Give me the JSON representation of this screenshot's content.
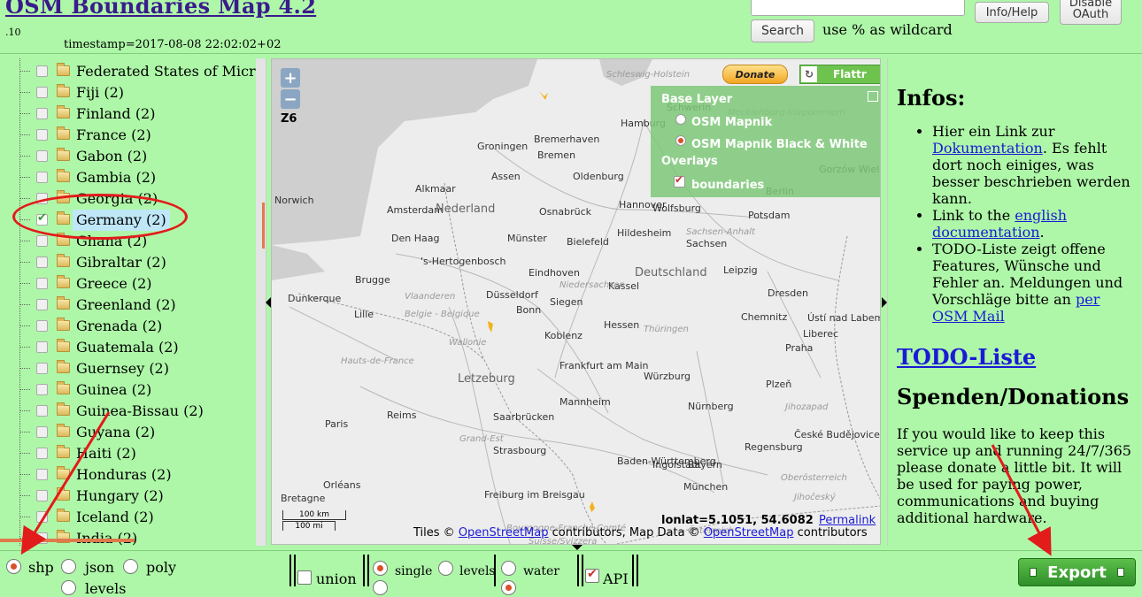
{
  "header": {
    "title": "OSM Boundaries Map 4.2",
    "version_suffix": ".10",
    "timestamp": "timestamp=2017-08-08 22:02:02+02",
    "search_value": "",
    "search_button": "Search",
    "wildcard_hint": "use % as wildcard",
    "info_button": "Info/Help",
    "oauth_button_line1": "Disable",
    "oauth_button_line2": "OAuth"
  },
  "tree": {
    "items": [
      {
        "label": "Federated States of Micronesia",
        "checked": false
      },
      {
        "label": "Fiji (2)",
        "checked": false
      },
      {
        "label": "Finland (2)",
        "checked": false
      },
      {
        "label": "France (2)",
        "checked": false
      },
      {
        "label": "Gabon (2)",
        "checked": false
      },
      {
        "label": "Gambia (2)",
        "checked": false
      },
      {
        "label": "Georgia (2)",
        "checked": false
      },
      {
        "label": "Germany (2)",
        "checked": true
      },
      {
        "label": "Ghana (2)",
        "checked": false
      },
      {
        "label": "Gibraltar (2)",
        "checked": false
      },
      {
        "label": "Greece (2)",
        "checked": false
      },
      {
        "label": "Greenland (2)",
        "checked": false
      },
      {
        "label": "Grenada (2)",
        "checked": false
      },
      {
        "label": "Guatemala (2)",
        "checked": false
      },
      {
        "label": "Guernsey (2)",
        "checked": false
      },
      {
        "label": "Guinea (2)",
        "checked": false
      },
      {
        "label": "Guinea-Bissau (2)",
        "checked": false
      },
      {
        "label": "Guyana (2)",
        "checked": false
      },
      {
        "label": "Haiti (2)",
        "checked": false
      },
      {
        "label": "Honduras (2)",
        "checked": false
      },
      {
        "label": "Hungary (2)",
        "checked": false
      },
      {
        "label": "Iceland (2)",
        "checked": false
      },
      {
        "label": "India (2)",
        "checked": false
      }
    ]
  },
  "map": {
    "zoom_in": "+",
    "zoom_out": "−",
    "zoom_level": "Z6",
    "donate": "Donate",
    "flattr": "Flattr",
    "layer_switcher": {
      "base_layer_title": "Base Layer",
      "base_layers": [
        "OSM Mapnik",
        "OSM Mapnik Black & White"
      ],
      "selected_base": "OSM Mapnik Black & White",
      "overlays_title": "Overlays",
      "overlays": [
        "boundaries"
      ]
    },
    "cities": [
      "Hamburg",
      "Bremerhaven",
      "Bremen",
      "Groningen",
      "Assen",
      "Oldenburg",
      "Alkmaar",
      "Norwich",
      "Amsterdam",
      "Nederland",
      "Osnabrück",
      "Hannover",
      "Wolfsburg",
      "Potsdam",
      "Berlin",
      "Den Haag",
      "Münster",
      "Bielefeld",
      "Hildesheim",
      "'s-Hertogenbosch",
      "Dunkerque",
      "Brugge",
      "Lille",
      "Düsseldorf",
      "Siegen",
      "Kassel",
      "Deutschland",
      "Leipzig",
      "Dresden",
      "Chemnitz",
      "Bonn",
      "Koblenz",
      "Frankfurt am Main",
      "Würzburg",
      "Letzeburg",
      "Praha",
      "Reims",
      "Saarbrücken",
      "Mannheim",
      "Nürnberg",
      "Plzeň",
      "Paris",
      "Strasbourg",
      "Ingolstadt",
      "Regensburg",
      "České Budějovice",
      "München",
      "Orléans",
      "Freiburg im Breisgau",
      "Schwerin",
      "Gorzów Wielkopolski",
      "Ústí nad Labem",
      "Liberec",
      "Eindhoven",
      "Hessen",
      "Sachsen",
      "Bayern",
      "Baden-Württemberg",
      "Bretagne"
    ],
    "regions": [
      "Schleswig-Holstein",
      "Mecklenburg-Vorpommern",
      "Niedersachsen",
      "Vlaanderen",
      "Belgie - Belgique",
      "Wallonie",
      "Hauts-de-France",
      "Grand-Est",
      "Bourgogne-Franche-Comté",
      "Oberösterreich",
      "Jihočeský",
      "Sachsen-Anhalt",
      "Thüringen",
      "Österreich",
      "Suisse/Svizzera",
      "Jihozapad"
    ],
    "scale_km": "100 km",
    "scale_mi": "100 mi",
    "lonlat": "lonlat=5.1051, 54.6082",
    "permalink": "Permalink",
    "attribution_prefix": "Tiles © ",
    "attribution_osm1": "OpenStreetMap",
    "attribution_middle": " contributors, Map Data © ",
    "attribution_osm2": "OpenStreetMap",
    "attribution_suffix": " contributors"
  },
  "info": {
    "title": "Infos:",
    "bullet1_prefix": "Hier ein Link zur ",
    "bullet1_link": "Dokumentation",
    "bullet1_suffix": ". Es fehlt dort noch einiges, was besser beschrieben werden kann.",
    "bullet2_prefix": "Link to the ",
    "bullet2_link": "english documentation",
    "bullet2_suffix": ".",
    "bullet3_prefix": "TODO-Liste zeigt offene Features, Wünsche und Fehler an. Meldungen und Vorschläge bitte an ",
    "bullet3_link": "per OSM Mail",
    "todo_link": "TODO-Liste",
    "donations_title": "Spenden/Donations",
    "donations_text": "If you would like to keep this service up and running 24/7/365 please donate a little bit. It will be used for paying power, communications and buying additional hardware."
  },
  "bottom": {
    "format_shp": "shp",
    "format_json": "json",
    "format_poly": "poly",
    "format_levels": "levels",
    "union": "union",
    "single": "single",
    "levels": "levels",
    "water": "water",
    "api": "API",
    "export": "Export"
  },
  "colors": {
    "panel_bg": "#aef7a8",
    "highlight": "#e21b1b",
    "title": "#3a1b8c",
    "export_button": "#3fa33a"
  }
}
